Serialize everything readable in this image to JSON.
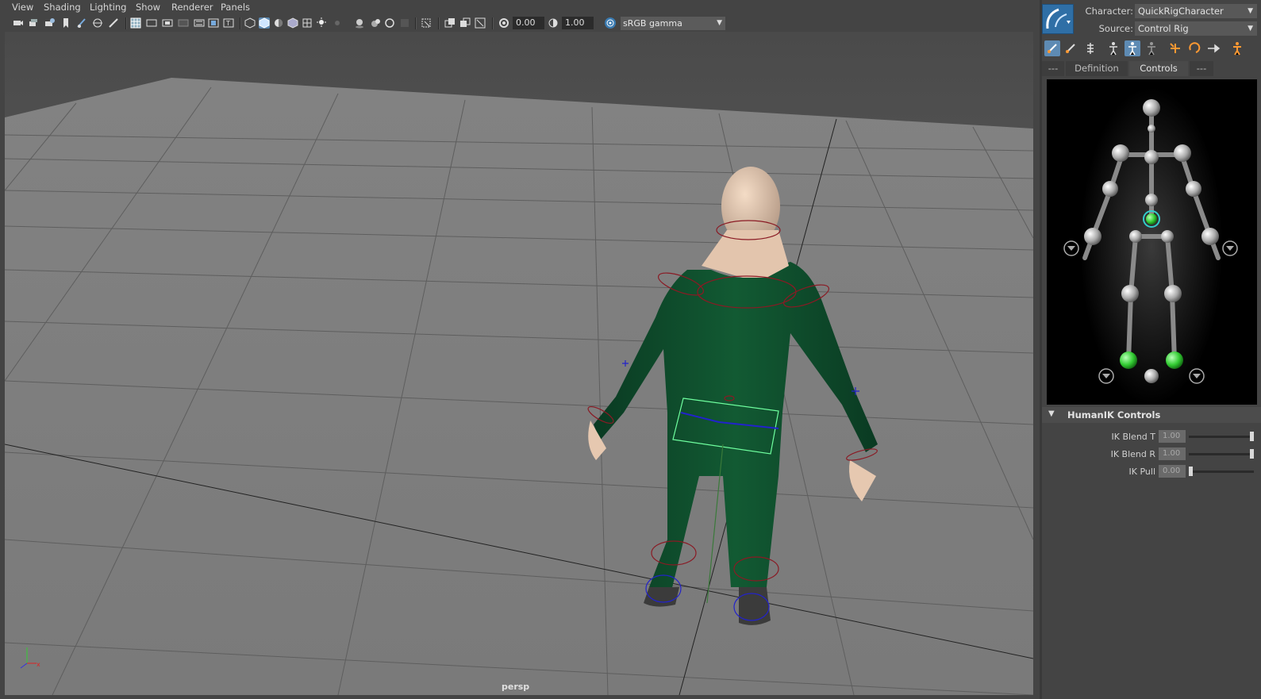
{
  "menubar": {
    "items": [
      "View",
      "Shading",
      "Lighting",
      "Show",
      "Renderer",
      "Panels"
    ]
  },
  "toolbar": {
    "exposure_value": "0.00",
    "gamma_value": "1.00",
    "color_space": "sRGB gamma",
    "icons": [
      "camera-select-icon",
      "camera-attributes-icon",
      "bookmarks-icon",
      "image-plane-icon",
      "grease-pencil-icon",
      "grid-icon",
      "film-gate-icon",
      "resolution-gate-icon",
      "gate-mask-icon",
      "field-chart-icon",
      "safe-action-icon",
      "safe-title-icon",
      "wireframe-icon",
      "smooth-shade-icon",
      "default-material-icon",
      "textured-icon",
      "lights-icon",
      "shadows-icon",
      "ssao-icon",
      "motion-blur-icon",
      "multisample-icon",
      "depth-of-field-icon",
      "isolate-select-icon",
      "xray-icon",
      "xray-joints-icon",
      "backface-culling-icon",
      "exposure-icon",
      "gamma-icon",
      "color-management-icon"
    ]
  },
  "viewport": {
    "camera_label": "persp"
  },
  "hik": {
    "character_label": "Character:",
    "character_value": "QuickRigCharacter",
    "source_label": "Source:",
    "source_value": "Control Rig",
    "tabs": [
      "---",
      "Definition",
      "Controls",
      "---"
    ],
    "active_tab": "Controls",
    "tools": [
      "full-body-icon",
      "body-part-icon",
      "select-effector-icon",
      "stance-pose-icon",
      "active-pin-icon",
      "pin-translate-icon",
      "reach-translate-icon",
      "reach-rotate-icon",
      "release-pin-icon",
      "mirror-icon"
    ],
    "section_title": "HumanIK Controls",
    "controls": [
      {
        "label": "IK Blend T",
        "value": "1.00",
        "level": 1.0
      },
      {
        "label": "IK Blend R",
        "value": "1.00",
        "level": 1.0
      },
      {
        "label": "IK Pull",
        "value": "0.00",
        "level": 0.0
      }
    ]
  },
  "colors": {
    "bg": "#444444",
    "viewport_floor": "#7a7a7a",
    "character_green": "#0f4a2a",
    "skin": "#e6c8b0",
    "control_red": "#8a1a24",
    "control_blue": "#2222cc",
    "selected_green": "#33dd44"
  }
}
